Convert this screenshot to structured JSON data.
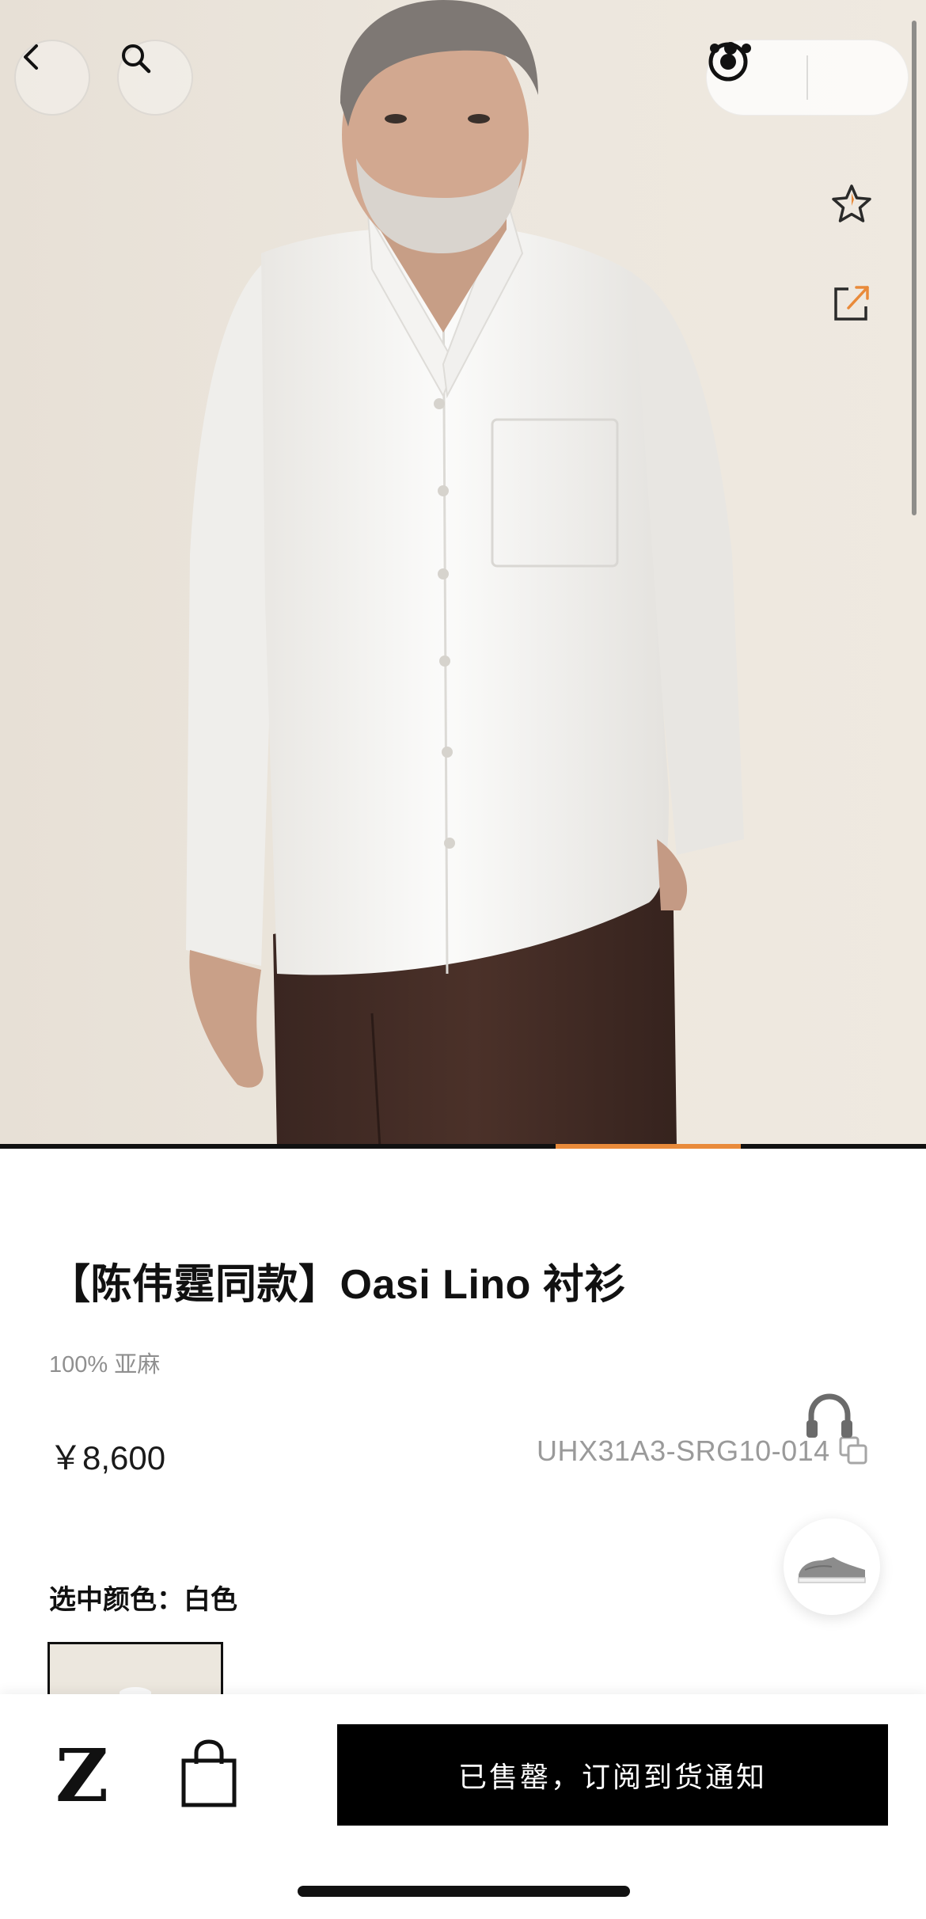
{
  "hero": {
    "image_alt": "",
    "carousel": {
      "total": 5,
      "active_index": 3
    }
  },
  "nav": {
    "back_icon": "chevron-left-icon",
    "search_icon": "search-icon",
    "more_icon": "more-dots-icon",
    "close_icon": "target-circle-icon"
  },
  "side_actions": {
    "favorite_icon": "star-icon",
    "share_icon": "share-icon"
  },
  "product": {
    "title": "【陈伟霆同款】Oasi Lino 衬衫",
    "material": "100% 亚麻",
    "price": "￥8,600",
    "sku": "UHX31A3-SRG10-014",
    "selected_color_label": "选中颜色：白色"
  },
  "floating": {
    "customer_service_icon": "headset-icon",
    "recommend_icon": "shoe-thumbnail-icon"
  },
  "bottom_bar": {
    "brand_logo": "Z",
    "bag_icon": "shopping-bag-icon",
    "notify_label": "已售罄，订阅到货通知"
  },
  "colors": {
    "accent": "#e98a3a",
    "button_bg": "#000000",
    "price_text": "#1a1a1a",
    "muted_text": "#9a9a9a"
  }
}
